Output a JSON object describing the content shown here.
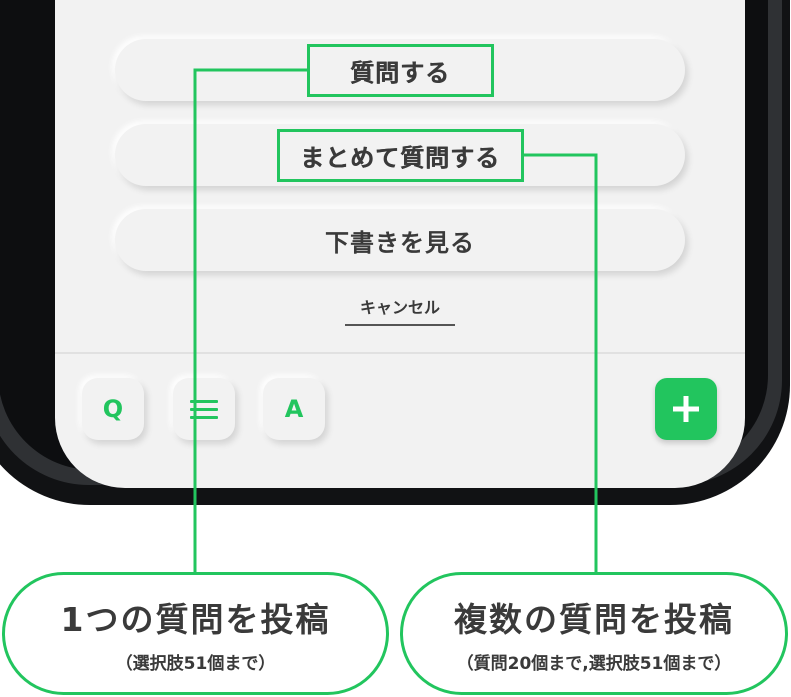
{
  "menu": {
    "ask": "質問する",
    "ask_batch": "まとめて質問する",
    "view_drafts": "下書きを見る",
    "cancel": "キャンセル"
  },
  "tabbar": {
    "q_label": "Q",
    "a_label": "A",
    "list_icon": "list-icon",
    "plus_icon": "plus-icon"
  },
  "callouts": {
    "single": {
      "title": "1つの質問を投稿",
      "note": "（選択肢51個まで）"
    },
    "multiple": {
      "title": "複数の質問を投稿",
      "note": "（質問20個まで,選択肢51個まで）"
    }
  },
  "colors": {
    "accent": "#22c55e",
    "screen_bg": "#f2f2f2",
    "frame": "#111214",
    "text": "#3a3a3a"
  }
}
